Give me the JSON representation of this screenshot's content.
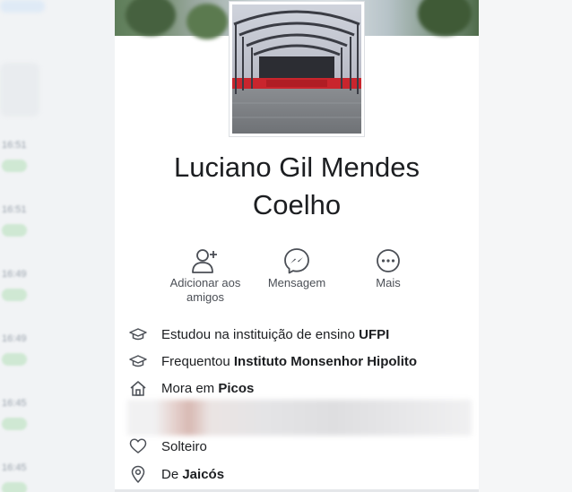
{
  "profile": {
    "name_line1": "Luciano Gil Mendes",
    "name_line2": "Coelho"
  },
  "actions": [
    {
      "label_line1": "Adicionar aos",
      "label_line2": "amigos",
      "icon": "add-friend-icon"
    },
    {
      "label_line1": "Mensagem",
      "label_line2": "",
      "icon": "messenger-icon"
    },
    {
      "label_line1": "Mais",
      "label_line2": "",
      "icon": "more-icon"
    }
  ],
  "info": {
    "studied_prefix": "Estudou na instituição de ensino ",
    "studied_value": "UFPI",
    "attends_prefix": "Frequentou ",
    "attends_value": "Instituto Monsenhor Hipolito",
    "lives_prefix": "Mora em ",
    "lives_value": "Picos",
    "relationship": "Solteiro",
    "from_prefix": "De ",
    "from_value": "Jaicós"
  },
  "colors": {
    "text": "#1c1e21",
    "secondary_text": "#4b4f56",
    "icon": "#4b4f56"
  }
}
